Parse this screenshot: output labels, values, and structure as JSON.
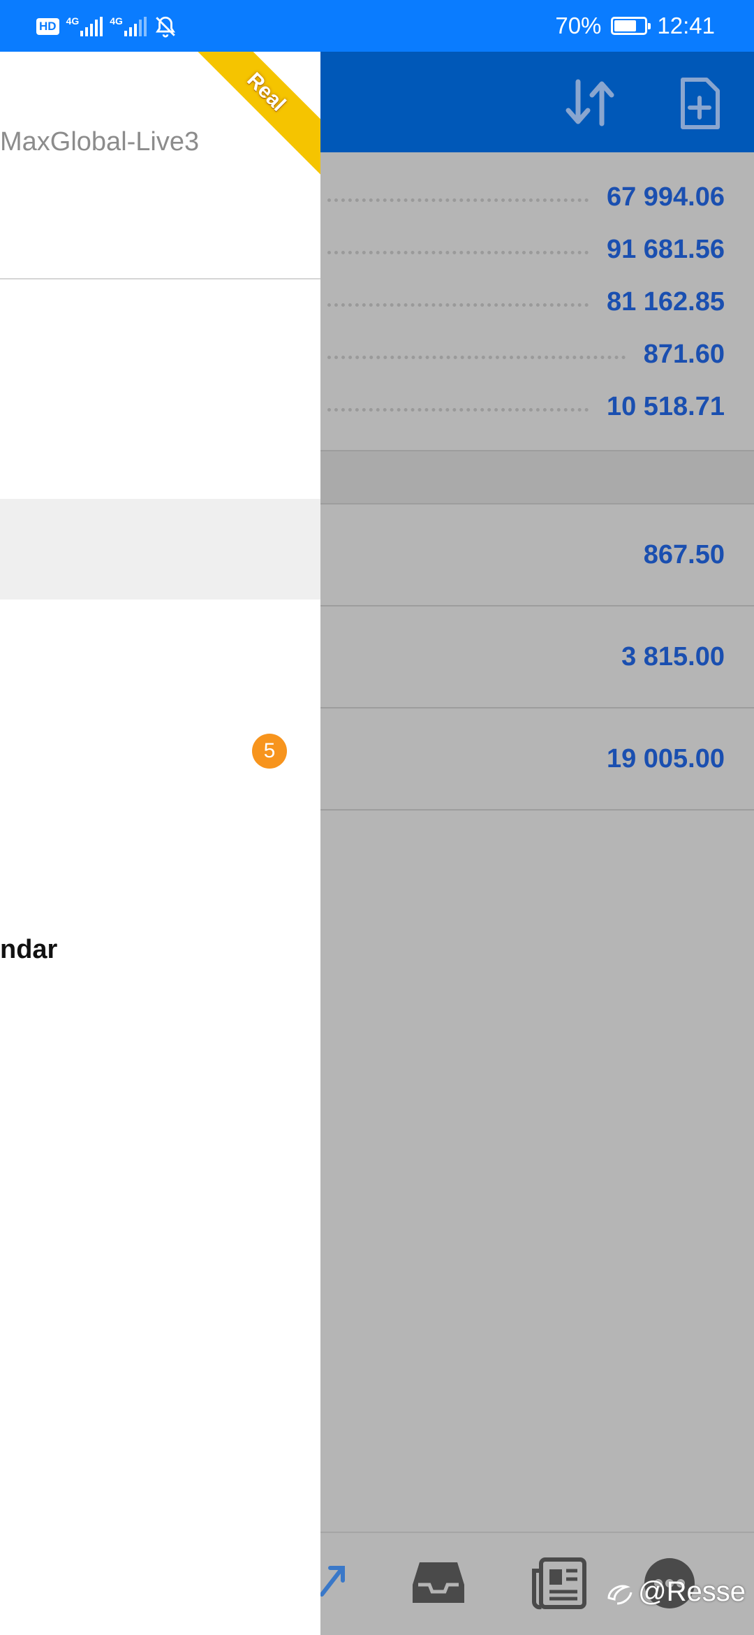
{
  "status_bar": {
    "hd_label": "HD",
    "network_1": "4G",
    "network_2": "4G",
    "battery_percent": "70%",
    "battery_level": 0.7,
    "time": "12:41"
  },
  "toolbar": {
    "icons": [
      "sort-arrows-icon",
      "new-document-icon"
    ]
  },
  "account_values": [
    "67 994.06",
    "91 681.56",
    "81 162.85",
    "871.60",
    "10 518.71"
  ],
  "position_values": [
    "867.50",
    "3 815.00",
    "19 005.00"
  ],
  "drawer": {
    "server_name": "MaxGlobal-Live3",
    "ribbon_label": "Real",
    "badge_count": "5",
    "menu_partial_label": "ndar"
  },
  "bottom_nav": {
    "icons": [
      "trade-arrow-icon",
      "inbox-icon",
      "news-icon",
      "chat-icon"
    ]
  },
  "watermark": {
    "text": "@Resse"
  },
  "colors": {
    "status_bar": "#0a7cff",
    "toolbar": "#0058b8",
    "value_text": "#1a4fb0",
    "ribbon": "#f5c400",
    "badge": "#f7941d"
  }
}
